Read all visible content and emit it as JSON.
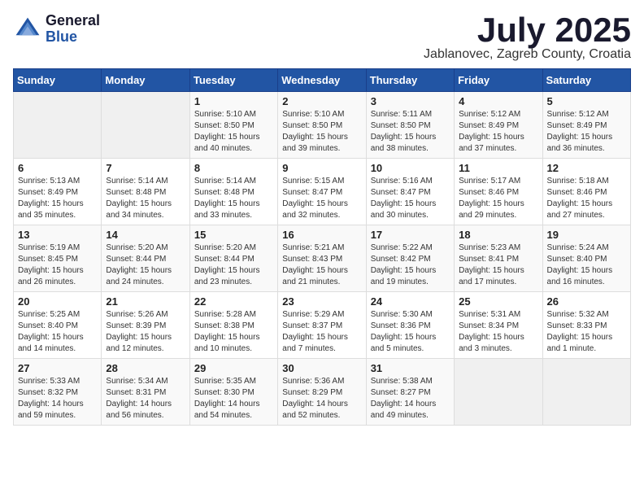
{
  "logo": {
    "general": "General",
    "blue": "Blue"
  },
  "title": {
    "month": "July 2025",
    "location": "Jablanovec, Zagreb County, Croatia"
  },
  "days_header": [
    "Sunday",
    "Monday",
    "Tuesday",
    "Wednesday",
    "Thursday",
    "Friday",
    "Saturday"
  ],
  "weeks": [
    [
      {
        "day": "",
        "empty": true
      },
      {
        "day": "",
        "empty": true
      },
      {
        "day": "1",
        "sunrise": "Sunrise: 5:10 AM",
        "sunset": "Sunset: 8:50 PM",
        "daylight": "Daylight: 15 hours and 40 minutes."
      },
      {
        "day": "2",
        "sunrise": "Sunrise: 5:10 AM",
        "sunset": "Sunset: 8:50 PM",
        "daylight": "Daylight: 15 hours and 39 minutes."
      },
      {
        "day": "3",
        "sunrise": "Sunrise: 5:11 AM",
        "sunset": "Sunset: 8:50 PM",
        "daylight": "Daylight: 15 hours and 38 minutes."
      },
      {
        "day": "4",
        "sunrise": "Sunrise: 5:12 AM",
        "sunset": "Sunset: 8:49 PM",
        "daylight": "Daylight: 15 hours and 37 minutes."
      },
      {
        "day": "5",
        "sunrise": "Sunrise: 5:12 AM",
        "sunset": "Sunset: 8:49 PM",
        "daylight": "Daylight: 15 hours and 36 minutes."
      }
    ],
    [
      {
        "day": "6",
        "sunrise": "Sunrise: 5:13 AM",
        "sunset": "Sunset: 8:49 PM",
        "daylight": "Daylight: 15 hours and 35 minutes."
      },
      {
        "day": "7",
        "sunrise": "Sunrise: 5:14 AM",
        "sunset": "Sunset: 8:48 PM",
        "daylight": "Daylight: 15 hours and 34 minutes."
      },
      {
        "day": "8",
        "sunrise": "Sunrise: 5:14 AM",
        "sunset": "Sunset: 8:48 PM",
        "daylight": "Daylight: 15 hours and 33 minutes."
      },
      {
        "day": "9",
        "sunrise": "Sunrise: 5:15 AM",
        "sunset": "Sunset: 8:47 PM",
        "daylight": "Daylight: 15 hours and 32 minutes."
      },
      {
        "day": "10",
        "sunrise": "Sunrise: 5:16 AM",
        "sunset": "Sunset: 8:47 PM",
        "daylight": "Daylight: 15 hours and 30 minutes."
      },
      {
        "day": "11",
        "sunrise": "Sunrise: 5:17 AM",
        "sunset": "Sunset: 8:46 PM",
        "daylight": "Daylight: 15 hours and 29 minutes."
      },
      {
        "day": "12",
        "sunrise": "Sunrise: 5:18 AM",
        "sunset": "Sunset: 8:46 PM",
        "daylight": "Daylight: 15 hours and 27 minutes."
      }
    ],
    [
      {
        "day": "13",
        "sunrise": "Sunrise: 5:19 AM",
        "sunset": "Sunset: 8:45 PM",
        "daylight": "Daylight: 15 hours and 26 minutes."
      },
      {
        "day": "14",
        "sunrise": "Sunrise: 5:20 AM",
        "sunset": "Sunset: 8:44 PM",
        "daylight": "Daylight: 15 hours and 24 minutes."
      },
      {
        "day": "15",
        "sunrise": "Sunrise: 5:20 AM",
        "sunset": "Sunset: 8:44 PM",
        "daylight": "Daylight: 15 hours and 23 minutes."
      },
      {
        "day": "16",
        "sunrise": "Sunrise: 5:21 AM",
        "sunset": "Sunset: 8:43 PM",
        "daylight": "Daylight: 15 hours and 21 minutes."
      },
      {
        "day": "17",
        "sunrise": "Sunrise: 5:22 AM",
        "sunset": "Sunset: 8:42 PM",
        "daylight": "Daylight: 15 hours and 19 minutes."
      },
      {
        "day": "18",
        "sunrise": "Sunrise: 5:23 AM",
        "sunset": "Sunset: 8:41 PM",
        "daylight": "Daylight: 15 hours and 17 minutes."
      },
      {
        "day": "19",
        "sunrise": "Sunrise: 5:24 AM",
        "sunset": "Sunset: 8:40 PM",
        "daylight": "Daylight: 15 hours and 16 minutes."
      }
    ],
    [
      {
        "day": "20",
        "sunrise": "Sunrise: 5:25 AM",
        "sunset": "Sunset: 8:40 PM",
        "daylight": "Daylight: 15 hours and 14 minutes."
      },
      {
        "day": "21",
        "sunrise": "Sunrise: 5:26 AM",
        "sunset": "Sunset: 8:39 PM",
        "daylight": "Daylight: 15 hours and 12 minutes."
      },
      {
        "day": "22",
        "sunrise": "Sunrise: 5:28 AM",
        "sunset": "Sunset: 8:38 PM",
        "daylight": "Daylight: 15 hours and 10 minutes."
      },
      {
        "day": "23",
        "sunrise": "Sunrise: 5:29 AM",
        "sunset": "Sunset: 8:37 PM",
        "daylight": "Daylight: 15 hours and 7 minutes."
      },
      {
        "day": "24",
        "sunrise": "Sunrise: 5:30 AM",
        "sunset": "Sunset: 8:36 PM",
        "daylight": "Daylight: 15 hours and 5 minutes."
      },
      {
        "day": "25",
        "sunrise": "Sunrise: 5:31 AM",
        "sunset": "Sunset: 8:34 PM",
        "daylight": "Daylight: 15 hours and 3 minutes."
      },
      {
        "day": "26",
        "sunrise": "Sunrise: 5:32 AM",
        "sunset": "Sunset: 8:33 PM",
        "daylight": "Daylight: 15 hours and 1 minute."
      }
    ],
    [
      {
        "day": "27",
        "sunrise": "Sunrise: 5:33 AM",
        "sunset": "Sunset: 8:32 PM",
        "daylight": "Daylight: 14 hours and 59 minutes."
      },
      {
        "day": "28",
        "sunrise": "Sunrise: 5:34 AM",
        "sunset": "Sunset: 8:31 PM",
        "daylight": "Daylight: 14 hours and 56 minutes."
      },
      {
        "day": "29",
        "sunrise": "Sunrise: 5:35 AM",
        "sunset": "Sunset: 8:30 PM",
        "daylight": "Daylight: 14 hours and 54 minutes."
      },
      {
        "day": "30",
        "sunrise": "Sunrise: 5:36 AM",
        "sunset": "Sunset: 8:29 PM",
        "daylight": "Daylight: 14 hours and 52 minutes."
      },
      {
        "day": "31",
        "sunrise": "Sunrise: 5:38 AM",
        "sunset": "Sunset: 8:27 PM",
        "daylight": "Daylight: 14 hours and 49 minutes."
      },
      {
        "day": "",
        "empty": true
      },
      {
        "day": "",
        "empty": true
      }
    ]
  ]
}
